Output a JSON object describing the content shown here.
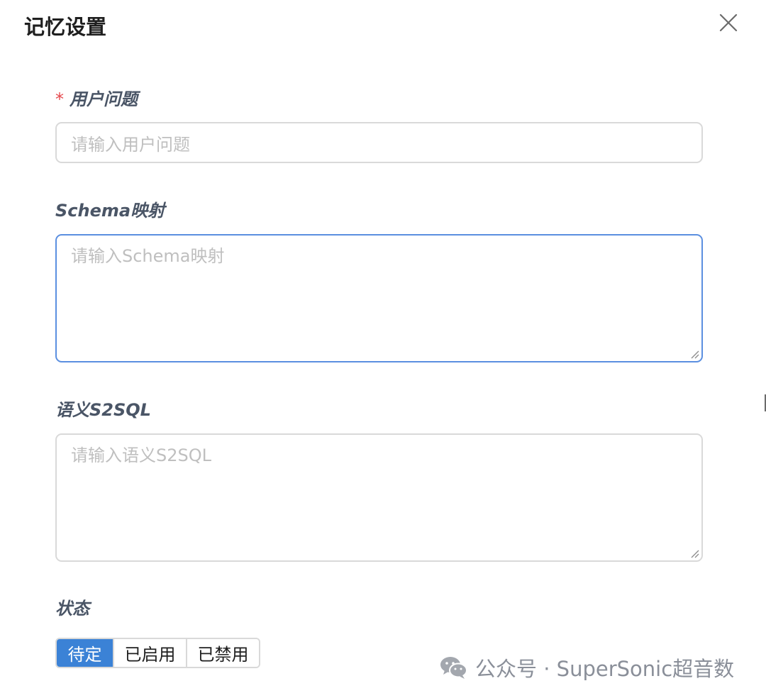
{
  "dialog": {
    "title": "记忆设置"
  },
  "form": {
    "question": {
      "required_mark": "*",
      "label": "用户问题",
      "placeholder": "请输入用户问题"
    },
    "schema": {
      "label": "Schema映射",
      "placeholder": "请输入Schema映射",
      "focused": true
    },
    "s2sql": {
      "label": "语义S2SQL",
      "placeholder": "请输入语义S2SQL"
    },
    "status": {
      "label": "状态",
      "options": [
        "待定",
        "已启用",
        "已禁用"
      ],
      "selected": "待定"
    }
  },
  "watermark": {
    "text": "公众号 · SuperSonic超音数"
  },
  "colors": {
    "accent": "#3b82d6",
    "focus_border": "#5b8fe0",
    "required": "#e5484d",
    "label": "#4a5566",
    "placeholder": "#bfbfbf"
  },
  "icons": {
    "close": "close-icon",
    "resize": "resize-handle-icon",
    "wechat": "wechat-icon"
  }
}
